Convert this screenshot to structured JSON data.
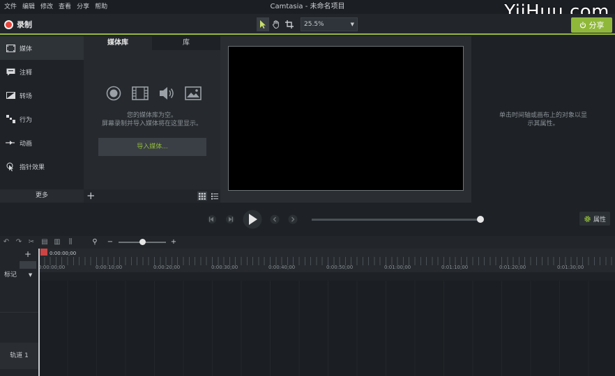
{
  "window": {
    "title": "Camtasia - 未命名项目",
    "watermark": "YiiHuu.com"
  },
  "menu": [
    "文件",
    "编辑",
    "修改",
    "查看",
    "分享",
    "帮助"
  ],
  "toolbar": {
    "record_label": "录制",
    "zoom_value": "25.5%",
    "share_label": "分享",
    "accent_color": "#8fb83a",
    "record_color": "#e8453c"
  },
  "sidebar": {
    "items": [
      {
        "label": "媒体",
        "icon": "film-icon"
      },
      {
        "label": "注释",
        "icon": "annotation-icon"
      },
      {
        "label": "转场",
        "icon": "transition-icon"
      },
      {
        "label": "行为",
        "icon": "behavior-icon"
      },
      {
        "label": "动画",
        "icon": "animation-icon"
      },
      {
        "label": "指针效果",
        "icon": "cursor-effect-icon"
      }
    ],
    "more_label": "更多"
  },
  "bin": {
    "tab_media": "媒体库",
    "tab_library": "库",
    "empty_line1": "您的媒体库为空。",
    "empty_line2": "屏幕录制并导入媒体将在这里显示。",
    "import_label": "导入媒体..."
  },
  "properties": {
    "empty_line1": "单击时间轴或画布上的对象以显",
    "empty_line2": "示其属性。",
    "button_label": "属性"
  },
  "timeline": {
    "playhead_time": "0:00:00;00",
    "marker_label": "标记",
    "track_label": "轨道 1",
    "ticks": [
      "0:00:00;00",
      "0:00:10;00",
      "0:00:20;00",
      "0:00:30;00",
      "0:00:40;00",
      "0:00:50;00",
      "0:01:00;00",
      "0:01:10;00",
      "0:01:20;00",
      "0:01:30;00"
    ]
  }
}
